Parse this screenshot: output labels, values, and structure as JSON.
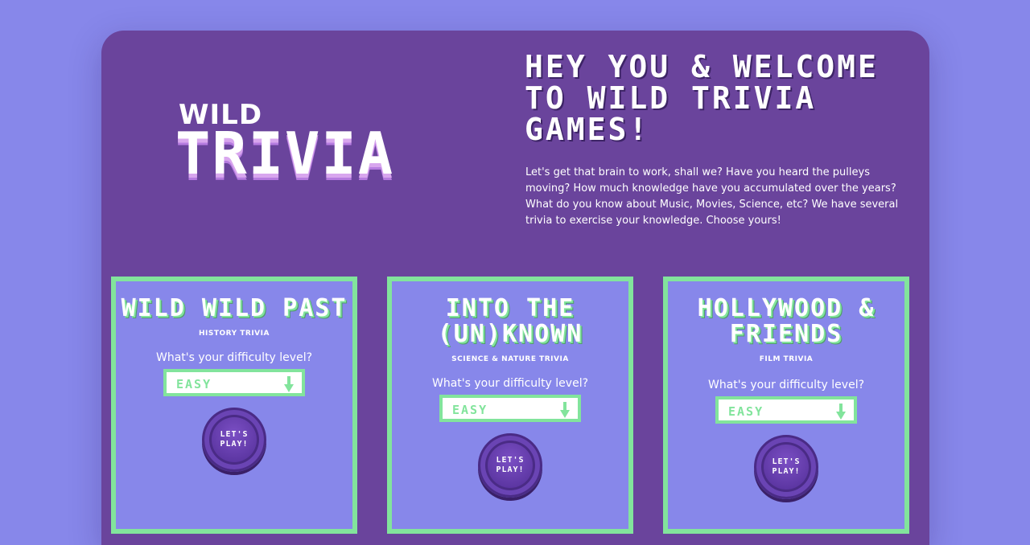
{
  "logo": {
    "small": "WILD",
    "big": "TRIVIA"
  },
  "hero": {
    "title": "HEY YOU & WELCOME TO WILD TRIVIA GAMES!",
    "text": "Let's get that brain to work, shall we? Have you heard the pulleys moving? How much knowledge have you accumulated over the years? What do you know about Music, Movies, Science, etc? We have several trivia to exercise your knowledge. Choose yours!"
  },
  "cards": [
    {
      "title": "WILD WILD PAST",
      "subtitle": "HISTORY TRIVIA",
      "question": "What's your difficulty level?",
      "difficulty": "EASY",
      "button": "LET'S PLAY!"
    },
    {
      "title": "INTO THE (UN)KNOWN",
      "subtitle": "SCIENCE & NATURE TRIVIA",
      "question": "What's your difficulty level?",
      "difficulty": "EASY",
      "button": "LET'S PLAY!"
    },
    {
      "title": "HOLLYWOOD & FRIENDS",
      "subtitle": "FILM TRIVIA",
      "question": "What's your difficulty level?",
      "difficulty": "EASY",
      "button": "LET'S PLAY!"
    }
  ],
  "colors": {
    "background": "#8787ea",
    "panel": "#6a449c",
    "accent": "#82e49c",
    "button": "#5c36a2"
  }
}
